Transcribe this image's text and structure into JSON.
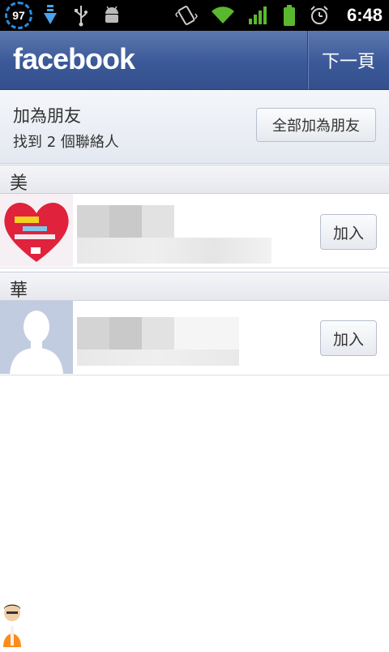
{
  "status_bar": {
    "battery_level": "97",
    "time": "6:48",
    "icons": [
      "download-icon",
      "usb-icon",
      "android-debug-icon",
      "vibrate-icon",
      "wifi-icon",
      "signal-icon",
      "battery-icon",
      "alarm-icon"
    ]
  },
  "header": {
    "logo": "facebook",
    "next_label": "下一頁"
  },
  "add_panel": {
    "title": "加為朋友",
    "subtitle": "找到 2 個聯絡人",
    "add_all_label": "全部加為朋友"
  },
  "sections": [
    {
      "label": "美",
      "contact": {
        "add_label": "加入"
      }
    },
    {
      "label": "華",
      "contact": {
        "add_label": "加入"
      }
    }
  ],
  "colors": {
    "facebook_blue": "#3b5998",
    "status_bar": "#000000"
  }
}
